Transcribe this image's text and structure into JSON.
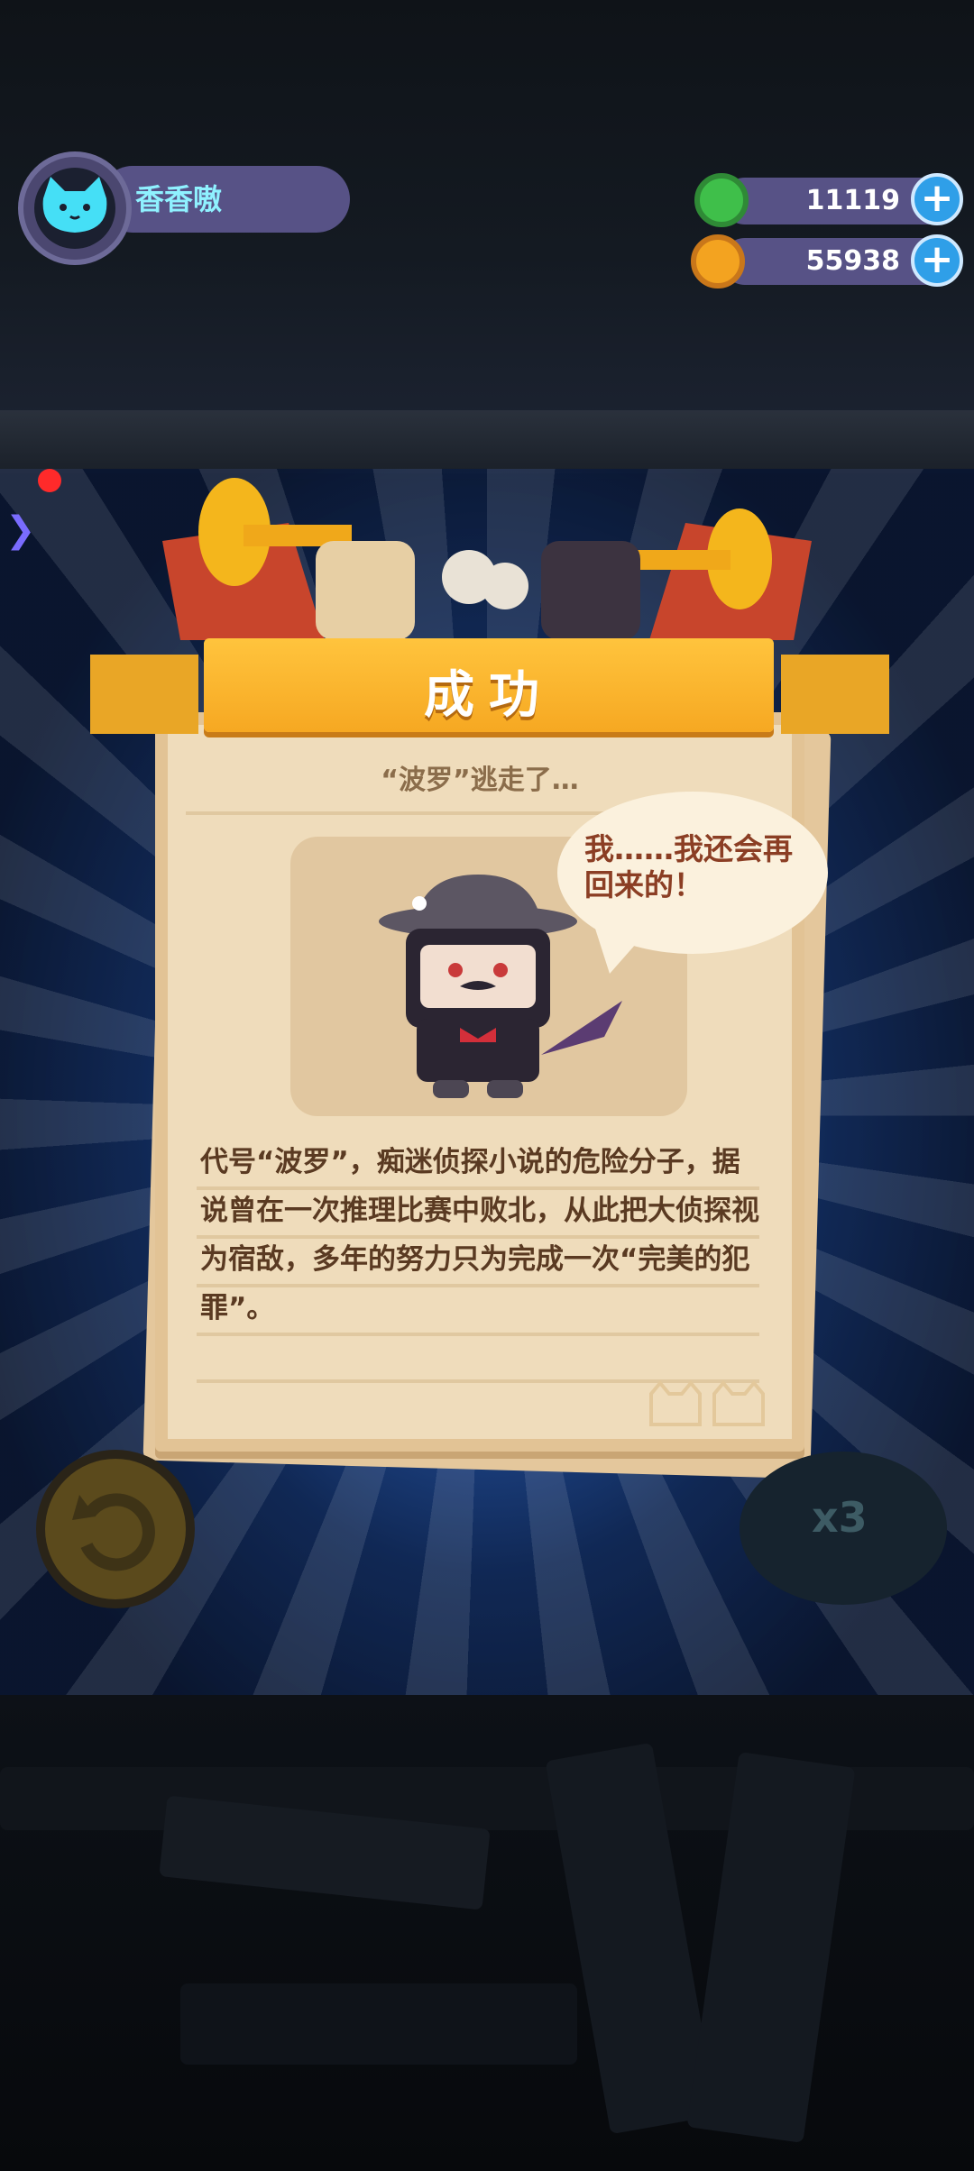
{
  "header": {
    "username": "香香嗷"
  },
  "currencies": [
    {
      "name": "green-gem",
      "value": "11119",
      "color": "#3fbf4a"
    },
    {
      "name": "gold-planet",
      "value": "55938",
      "color": "#f3a320"
    }
  ],
  "result": {
    "title": "成功",
    "subtitle": "“波罗”逃走了…",
    "speech": "我……我还会再回来的！",
    "description": "代号“波罗”，痴迷侦探小说的危险分子，据说曾在一次推理比赛中败北，从此把大侦探视为宿敌，多年的努力只为完成一次“完美的犯罪”。"
  },
  "controls": {
    "speed_label": "x3"
  },
  "colors": {
    "ribbon": "#f7b42c",
    "card": "#efdcbb",
    "text_dark": "#5a3a22",
    "accent_blue": "#2f9fe8"
  }
}
